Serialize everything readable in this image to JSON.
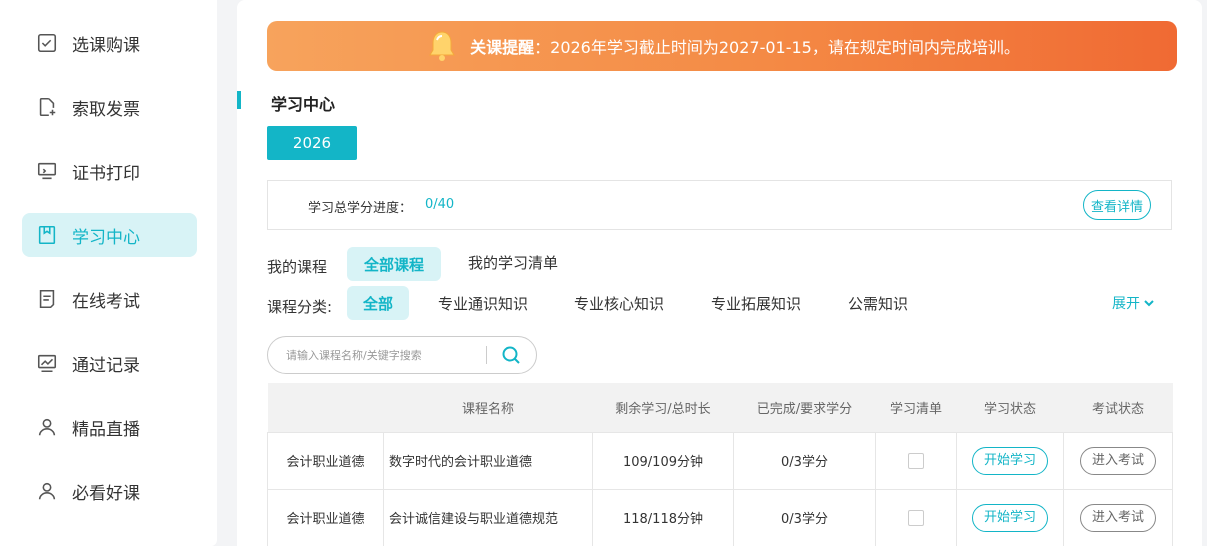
{
  "sidebar": {
    "items": [
      {
        "label": "选课购课",
        "icon": "checkbox-icon"
      },
      {
        "label": "索取发票",
        "icon": "document-add-icon"
      },
      {
        "label": "证书打印",
        "icon": "monitor-icon"
      },
      {
        "label": "学习中心",
        "icon": "bookmark-icon",
        "active": true
      },
      {
        "label": "在线考试",
        "icon": "exam-icon"
      },
      {
        "label": "通过记录",
        "icon": "chart-icon"
      },
      {
        "label": "精品直播",
        "icon": "user-icon"
      },
      {
        "label": "必看好课",
        "icon": "user-icon"
      }
    ]
  },
  "notice": {
    "title": "关课提醒",
    "message": "：2026年学习截止时间为2027-01-15，请在规定时间内完成培训。"
  },
  "section": {
    "title": "学习中心"
  },
  "year": {
    "label": "2026"
  },
  "progress": {
    "label": "学习总学分进度：",
    "value": "0/40",
    "detail_button": "查看详情"
  },
  "my_courses": {
    "label": "我的课程",
    "tabs": [
      "全部课程",
      "我的学习清单"
    ]
  },
  "categories": {
    "label": "课程分类:",
    "items": [
      "全部",
      "专业通识知识",
      "专业核心知识",
      "专业拓展知识",
      "公需知识"
    ],
    "expand": "展开"
  },
  "search": {
    "placeholder": "请输入课程名称/关键字搜索"
  },
  "table": {
    "headers": [
      "",
      "课程名称",
      "剩余学习/总时长",
      "已完成/要求学分",
      "学习清单",
      "学习状态",
      "考试状态"
    ],
    "rows": [
      {
        "category": "会计职业道德",
        "name": "数字时代的会计职业道德",
        "duration": "109/109分钟",
        "credits": "0/3学分",
        "study_button": "开始学习",
        "exam_button": "进入考试"
      },
      {
        "category": "会计职业道德",
        "name": "会计诚信建设与职业道德规范",
        "duration": "118/118分钟",
        "credits": "0/3学分",
        "study_button": "开始学习",
        "exam_button": "进入考试"
      }
    ]
  },
  "colors": {
    "accent": "#13b5c7",
    "notice_start": "#f7a35c",
    "notice_end": "#f06a33"
  }
}
